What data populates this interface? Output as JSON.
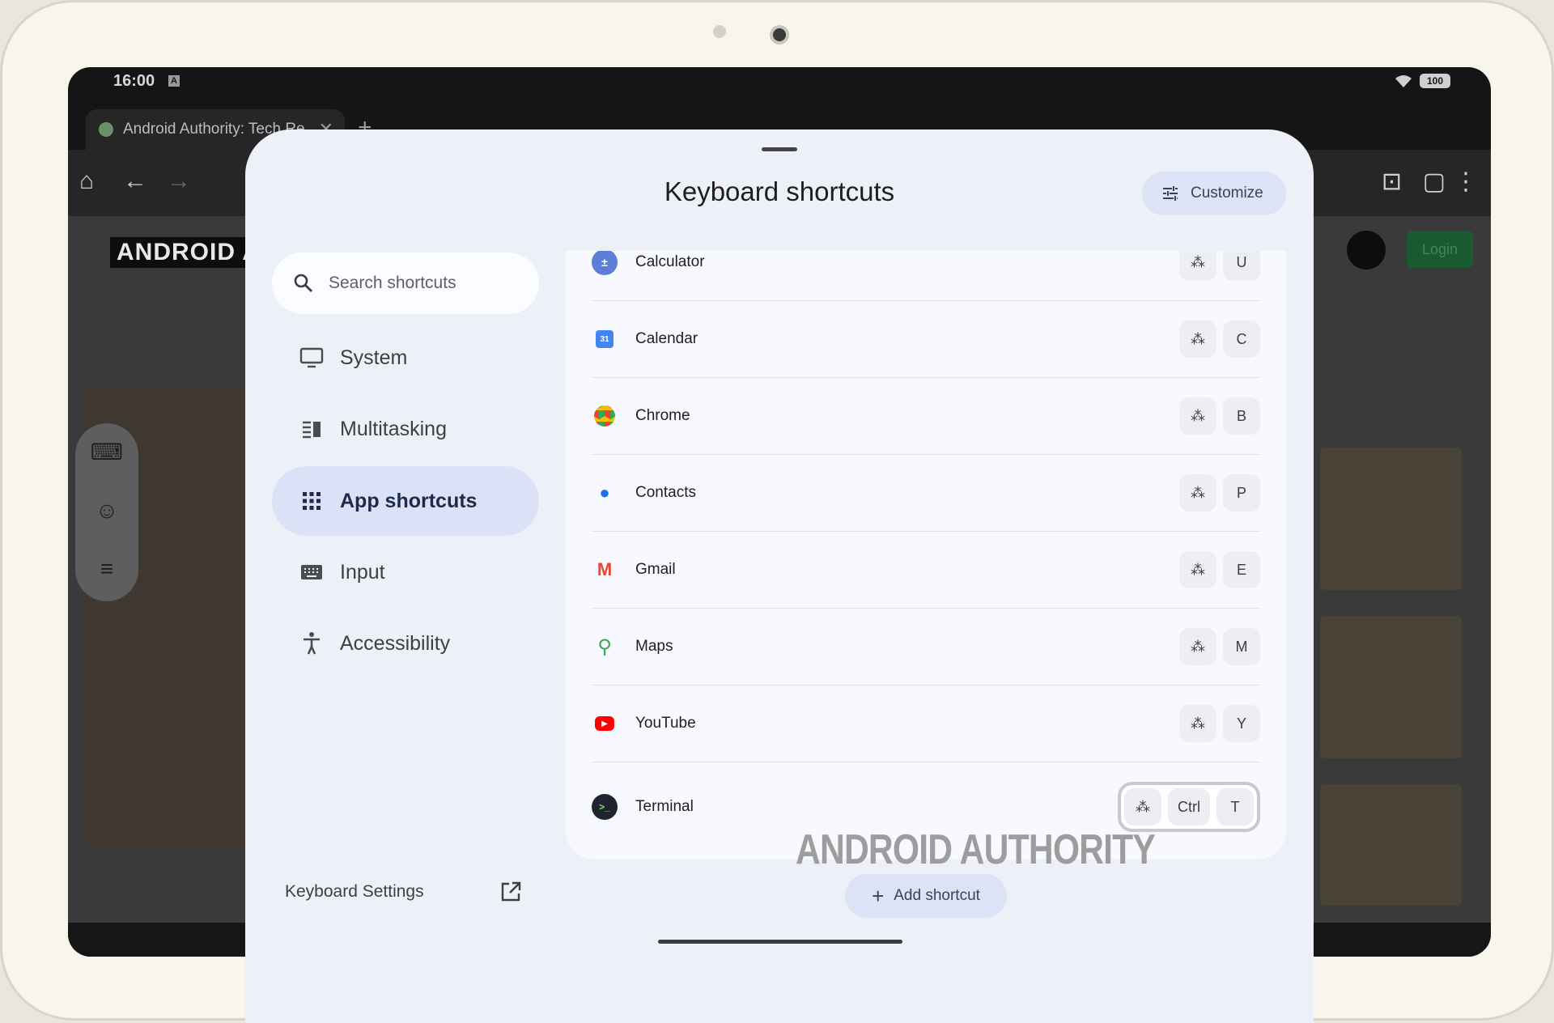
{
  "status_bar": {
    "time": "16:00",
    "notif_icon": "A",
    "battery": "100"
  },
  "browser": {
    "tab_title": "Android Authority: Tech Re",
    "tab_close": "✕",
    "new_tab": "+"
  },
  "webpage": {
    "logo": "ANDROID AU",
    "login": "Login"
  },
  "dialog": {
    "title": "Keyboard shortcuts",
    "customize_label": "Customize",
    "search_placeholder": "Search shortcuts",
    "nav": [
      {
        "label": "System",
        "icon": "monitor-icon"
      },
      {
        "label": "Multitasking",
        "icon": "multitasking-icon"
      },
      {
        "label": "App shortcuts",
        "icon": "apps-grid-icon",
        "active": true
      },
      {
        "label": "Input",
        "icon": "keyboard-icon"
      },
      {
        "label": "Accessibility",
        "icon": "accessibility-icon"
      }
    ],
    "keyboard_settings": "Keyboard Settings",
    "shortcuts": [
      {
        "name": "Calculator",
        "keys": [
          "U"
        ]
      },
      {
        "name": "Calendar",
        "keys": [
          "C"
        ]
      },
      {
        "name": "Chrome",
        "keys": [
          "B"
        ]
      },
      {
        "name": "Contacts",
        "keys": [
          "P"
        ]
      },
      {
        "name": "Gmail",
        "keys": [
          "E"
        ]
      },
      {
        "name": "Maps",
        "keys": [
          "M"
        ]
      },
      {
        "name": "YouTube",
        "keys": [
          "Y"
        ]
      },
      {
        "name": "Terminal",
        "keys": [
          "Ctrl",
          "T"
        ]
      }
    ],
    "watermark": "ANDROID AUTHORITY",
    "add_shortcut_label": "Add shortcut"
  },
  "colors": {
    "accent": "#dbe2f7",
    "sheet_bg": "#eef0f8"
  }
}
